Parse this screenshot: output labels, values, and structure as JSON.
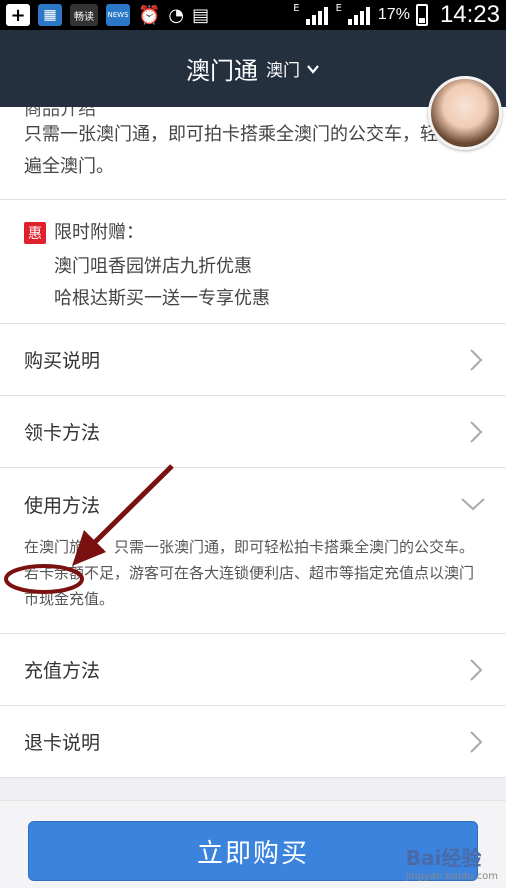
{
  "status_bar": {
    "app_icons": [
      "畅读",
      "NEWS"
    ],
    "network_type": "E",
    "battery_percent": "17%",
    "time": "14:23"
  },
  "nav": {
    "title": "澳门通",
    "city": "澳门"
  },
  "intro": {
    "cut_heading": "商品介绍",
    "text": "只需一张澳门通，即可拍卡搭乘全澳门的公交车，轻松游遍全澳门。"
  },
  "gift": {
    "badge": "惠",
    "title": "限时附赠：",
    "items": [
      "澳门咀香园饼店九折优惠",
      "哈根达斯买一送一专享优惠"
    ]
  },
  "rows": {
    "purchase_info": "购买说明",
    "get_card": "领卡方法",
    "usage": "使用方法",
    "recharge": "充值方法",
    "refund": "退卡说明"
  },
  "usage_text": "在澳门旅游，只需一张澳门通，即可轻松拍卡搭乘全澳门的公交车。若卡余额不足，游客可在各大连锁便利店、超市等指定充值点以澳门币现金充值。",
  "buy_button": "立即购买",
  "watermark": {
    "brand": "Bai经验",
    "url": "jingyan.baidu.com"
  },
  "colors": {
    "navbar": "#25303f",
    "button": "#3b83dd",
    "badge": "#e0202a",
    "annotation": "#7a1010"
  }
}
